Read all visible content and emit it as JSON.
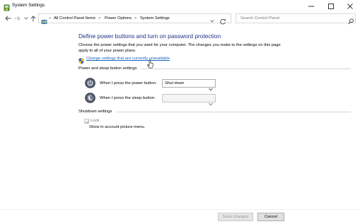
{
  "window": {
    "title": "System Settings"
  },
  "address_bar": {
    "breadcrumbs": [
      "All Control Panel Items",
      "Power Options",
      "System Settings"
    ],
    "overflow": "«",
    "separator": ">"
  },
  "search": {
    "placeholder": "Search Control Panel"
  },
  "main": {
    "heading": "Define power buttons and turn on password protection",
    "description": "Choose the power settings that you want for your computer. The changes you make to the settings on this page apply to all of your power plans.",
    "change_link": "Change settings that are currently unavailable",
    "power_section": {
      "title": "Power and sleep button settings",
      "rows": [
        {
          "label": "When I press the power button:",
          "value": "Shut down",
          "enabled": true
        },
        {
          "label": "When I press the sleep button:",
          "value": "",
          "enabled": false
        }
      ]
    },
    "shutdown_section": {
      "title": "Shutdown settings",
      "lock_label": "Lock",
      "lock_checked": true,
      "lock_description": "Show in account picture menu."
    }
  },
  "footer": {
    "save_label": "Save changes",
    "cancel_label": "Cancel"
  },
  "icons": {
    "app": "power-options-icon",
    "shield": "uac-shield-icon",
    "power_button": "power-button-icon",
    "sleep_button": "sleep-button-icon"
  },
  "colors": {
    "heading": "#1e3287",
    "link": "#1a65c0"
  }
}
